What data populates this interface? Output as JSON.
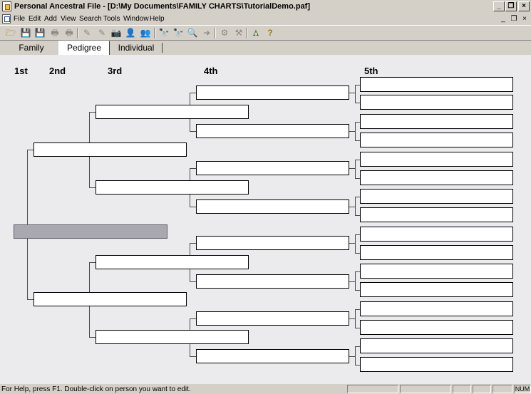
{
  "window": {
    "title": "Personal Ancestral File - [D:\\My Documents\\FAMILY CHARTS\\TutorialDemo.paf]",
    "caption_buttons": [
      "minimize",
      "restore",
      "close"
    ]
  },
  "menubar": {
    "items": [
      "File",
      "Edit",
      "Add",
      "View",
      "Search",
      "Tools",
      "Window",
      "Help"
    ],
    "mdi_buttons": [
      "minimize",
      "restore",
      "close"
    ]
  },
  "toolbar": {
    "icons": [
      "open-folder-icon",
      "save-icon",
      "save-as-icon",
      "print-preview-icon",
      "print-icon",
      "edit-person-icon",
      "edit-family-icon",
      "camera-icon",
      "add-individual-icon",
      "add-family-icon",
      "search-binoculars-icon",
      "search-next-icon",
      "find-icon",
      "navigate-icon",
      "tools-icon",
      "merge-icon",
      "pedigree-icon",
      "help-icon"
    ],
    "glyphs": [
      "🗁",
      "💾",
      "💾",
      "🖶",
      "🖶",
      "✎",
      "✎",
      "📷",
      "👤",
      "👥",
      "🔭",
      "🔭",
      "🔍",
      "➜",
      "⚙",
      "⚒",
      "⛼",
      "?"
    ]
  },
  "tabs": [
    {
      "label": "Family",
      "active": false
    },
    {
      "label": "Pedigree",
      "active": true
    },
    {
      "label": "Individual",
      "active": false
    }
  ],
  "pedigree": {
    "generation_labels": [
      "1st",
      "2nd",
      "3rd",
      "4th",
      "5th"
    ],
    "generations": [
      {
        "count": 1,
        "names": [
          ""
        ],
        "selected_index": 0
      },
      {
        "count": 2,
        "names": [
          "",
          ""
        ]
      },
      {
        "count": 4,
        "names": [
          "",
          "",
          "",
          ""
        ]
      },
      {
        "count": 8,
        "names": [
          "",
          "",
          "",
          "",
          "",
          "",
          "",
          ""
        ]
      },
      {
        "count": 16,
        "names": [
          "",
          "",
          "",
          "",
          "",
          "",
          "",
          "",
          "",
          "",
          "",
          "",
          "",
          "",
          "",
          ""
        ]
      }
    ]
  },
  "statusbar": {
    "message": "For Help, press F1. Double-click on person you want to edit.",
    "panels": [
      "",
      "",
      "",
      "",
      "",
      "NUM"
    ]
  },
  "colors": {
    "chrome": "#d4d0c8",
    "canvas": "#ebebee",
    "selected_box": "#a9a8b1",
    "connector": "#4a4a4a"
  }
}
